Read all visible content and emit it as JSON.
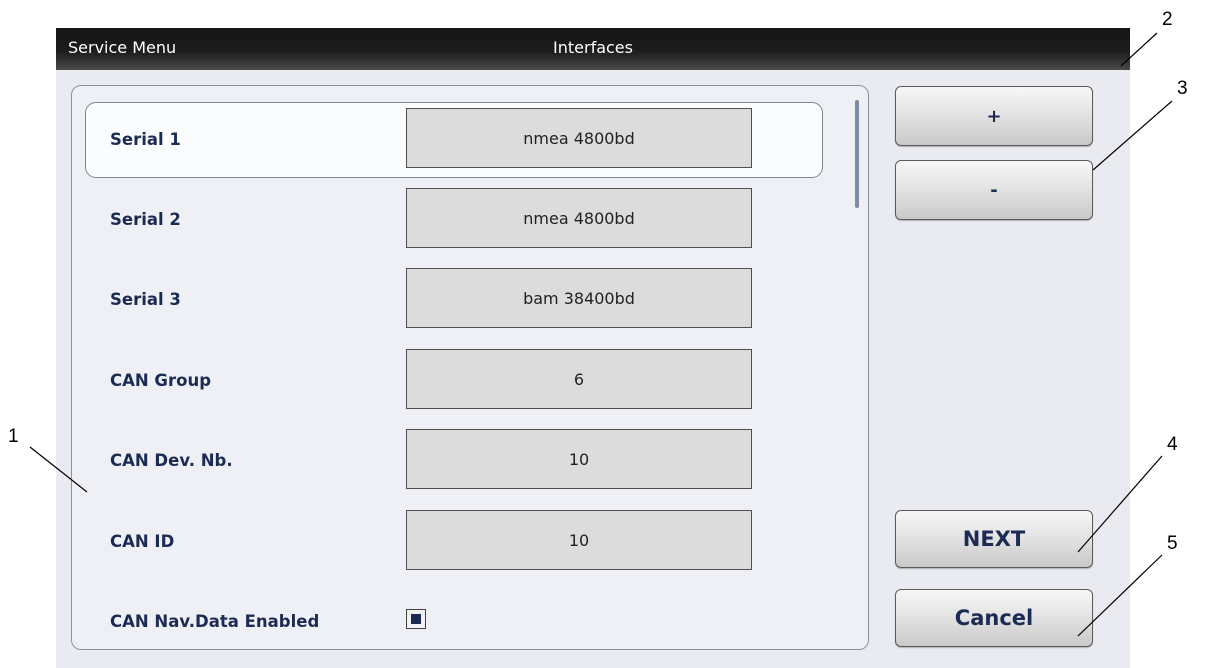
{
  "titlebar": {
    "left": "Service Menu",
    "center": "Interfaces"
  },
  "rows": [
    {
      "label": "Serial 1",
      "value": "nmea 4800bd",
      "selected": true
    },
    {
      "label": "Serial 2",
      "value": "nmea 4800bd"
    },
    {
      "label": "Serial 3",
      "value": "bam 38400bd"
    },
    {
      "label": "CAN Group",
      "value": "6"
    },
    {
      "label": "CAN Dev. Nb.",
      "value": "10"
    },
    {
      "label": "CAN ID",
      "value": "10"
    }
  ],
  "checkbox_row": {
    "label": "CAN Nav.Data Enabled",
    "checked": true
  },
  "buttons": {
    "plus": "+",
    "minus": "-",
    "next": "NEXT",
    "cancel": "Cancel"
  },
  "callouts": [
    "1",
    "2",
    "3",
    "4",
    "5"
  ],
  "colors": {
    "titlebar": "#1c1c1c",
    "label_text": "#1b2b53",
    "screen_bg": "#e9ebf1"
  }
}
